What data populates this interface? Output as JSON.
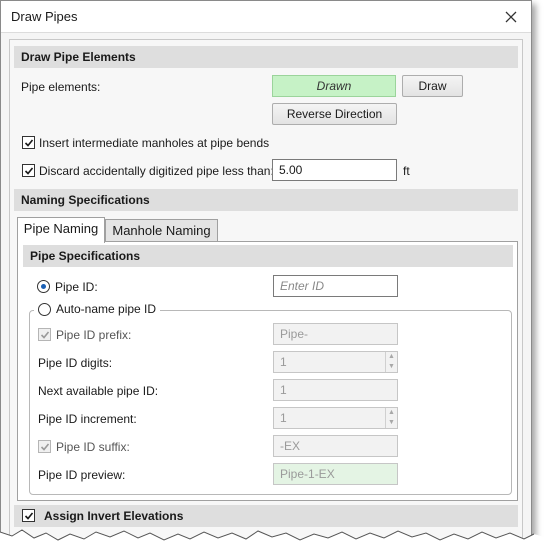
{
  "window": {
    "title": "Draw Pipes"
  },
  "draw_section": {
    "header": "Draw Pipe Elements",
    "pipe_elements_label": "Pipe elements:",
    "status": "Drawn",
    "draw_button": "Draw",
    "reverse_button": "Reverse Direction",
    "insert_manholes_label": "Insert intermediate manholes at pipe bends",
    "insert_manholes_checked": true,
    "discard_label": "Discard accidentally digitized pipe less than:",
    "discard_checked": true,
    "discard_value": "5.00",
    "discard_unit": "ft"
  },
  "naming_section": {
    "header": "Naming Specifications",
    "tabs": [
      {
        "label": "Pipe Naming",
        "active": true
      },
      {
        "label": "Manhole Naming",
        "active": false
      }
    ]
  },
  "pipe_specs": {
    "header": "Pipe Specifications",
    "pipe_id_radio_label": "Pipe ID:",
    "pipe_id_selected": true,
    "pipe_id_placeholder": "Enter ID",
    "auto_name_label": "Auto-name pipe ID",
    "auto_name_selected": false,
    "prefix_label": "Pipe ID prefix:",
    "prefix_checked": true,
    "prefix_value": "Pipe-",
    "digits_label": "Pipe ID digits:",
    "digits_value": "1",
    "next_label": "Next available pipe ID:",
    "next_value": "1",
    "increment_label": "Pipe ID increment:",
    "increment_value": "1",
    "suffix_label": "Pipe ID suffix:",
    "suffix_checked": true,
    "suffix_value": "-EX",
    "preview_label": "Pipe ID preview:",
    "preview_value": "Pipe-1-EX"
  },
  "invert_section": {
    "label": "Assign Invert Elevations",
    "checked": true
  },
  "colors": {
    "status_green": "#c6f2c6",
    "preview_green": "#e4f4e4",
    "radio_accent": "#1a5fb4"
  }
}
